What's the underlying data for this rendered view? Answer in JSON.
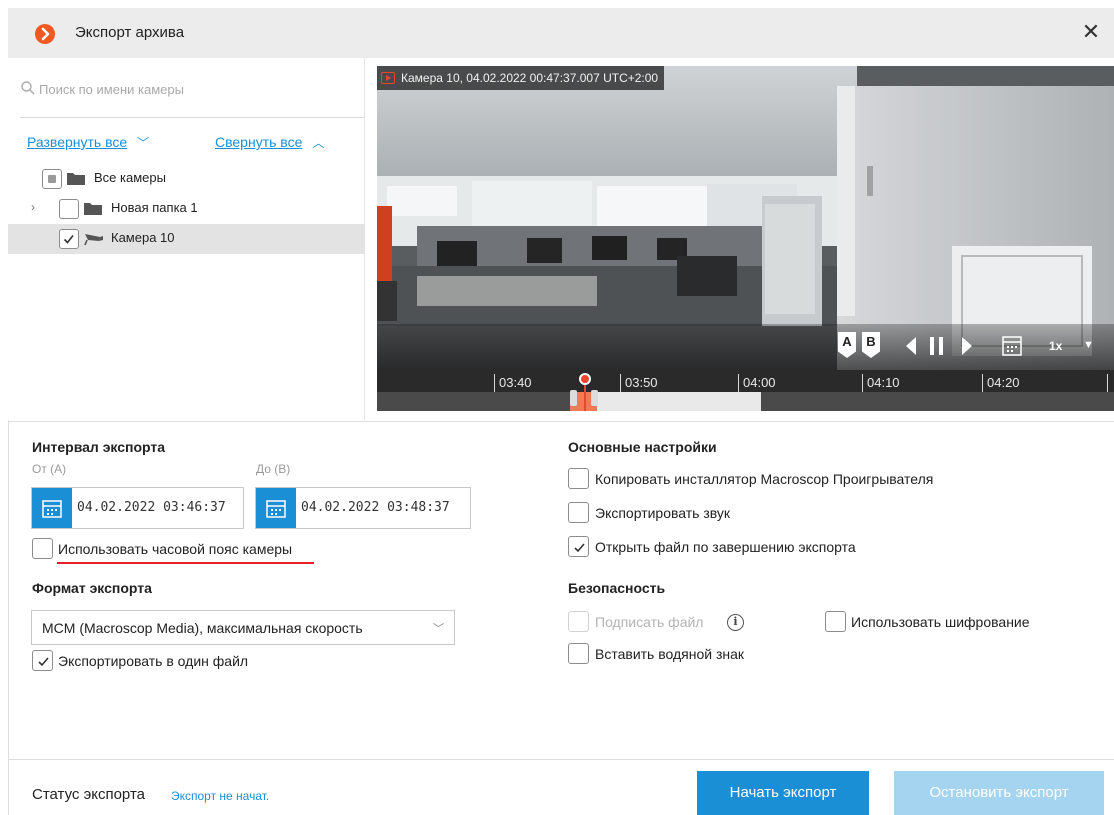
{
  "window": {
    "title": "Экспорт архива",
    "close_glyph": "✕"
  },
  "sidebar": {
    "search_placeholder": "Поиск по имени камеры",
    "expand_all": "Развернуть все",
    "collapse_all": "Свернуть все",
    "tree": [
      {
        "label": "Все камеры",
        "icon": "folder-icon",
        "state": "partial"
      },
      {
        "label": "Новая папка 1",
        "icon": "folder-icon",
        "state": "unchecked",
        "expandable": true
      },
      {
        "label": "Камера 10",
        "icon": "camera-icon",
        "state": "checked",
        "selected": true
      }
    ]
  },
  "player": {
    "caption": "Камера 10, 04.02.2022 00:47:37.007 UTC+2:00",
    "marker_a": "A",
    "marker_b": "B",
    "speed": "1x",
    "timeline_labels": [
      "03:40",
      "03:50",
      "04:00",
      "04:10",
      "04:20"
    ]
  },
  "interval": {
    "title": "Интервал экспорта",
    "from_label": "От (A)",
    "to_label": "До (B)",
    "from_value": "04.02.2022 03:46:37",
    "to_value": "04.02.2022 03:48:37",
    "timezone_label": "Использовать часовой пояс камеры",
    "timezone_checked": false
  },
  "format": {
    "title": "Формат экспорта",
    "selected": "MCM (Macroscop Media), максимальная скорость",
    "single_file_label": "Экспортировать в один файл",
    "single_file_checked": true
  },
  "settings": {
    "title": "Основные настройки",
    "copy_installer": "Копировать инсталлятор Macroscop Проигрывателя",
    "export_sound": "Экспортировать звук",
    "open_file": "Открыть файл по завершению экспорта"
  },
  "security": {
    "title": "Безопасность",
    "sign_file": "Подписать файл",
    "use_encryption": "Использовать шифрование",
    "watermark": "Вставить водяной знак"
  },
  "footer": {
    "status_label": "Статус экспорта",
    "status_value": "Экспорт не начат.",
    "start_button": "Начать экспорт",
    "stop_button": "Остановить экспорт"
  },
  "colors": {
    "accent": "#1b8fd6",
    "brand": "#f05a22",
    "disabled_button": "#a5d4f0",
    "highlight_underline": "#e8202a"
  }
}
